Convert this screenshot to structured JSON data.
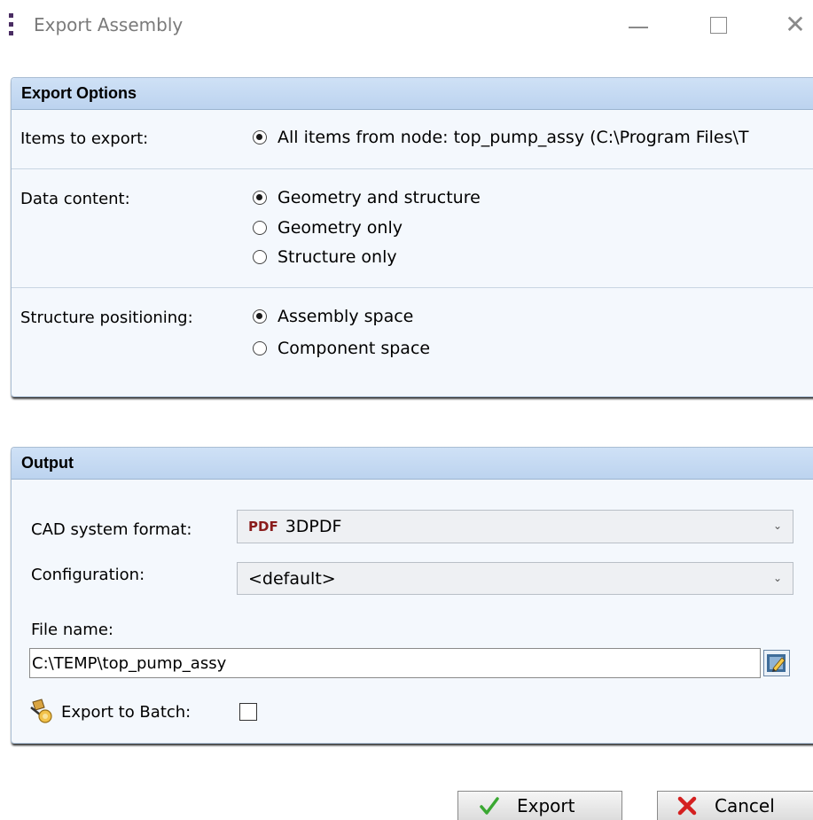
{
  "window": {
    "title": "Export Assembly",
    "minimize_icon": "minimize-icon",
    "maximize_icon": "maximize-icon",
    "close_icon": "close-icon"
  },
  "export_options": {
    "header": "Export Options",
    "items_to_export": {
      "label": "Items to export:",
      "options": [
        {
          "label": "All items from node: top_pump_assy (C:\\Program Files\\T",
          "selected": true
        }
      ]
    },
    "data_content": {
      "label": "Data content:",
      "options": [
        {
          "label": "Geometry and structure",
          "selected": true
        },
        {
          "label": "Geometry only",
          "selected": false
        },
        {
          "label": "Structure only",
          "selected": false
        }
      ]
    },
    "structure_positioning": {
      "label": "Structure positioning:",
      "options": [
        {
          "label": "Assembly space",
          "selected": true
        },
        {
          "label": "Component space",
          "selected": false
        }
      ]
    }
  },
  "output": {
    "header": "Output",
    "cad_format": {
      "label": "CAD system format:",
      "badge": "PDF",
      "value": "3DPDF"
    },
    "configuration": {
      "label": "Configuration:",
      "value": "<default>"
    },
    "file_name": {
      "label": "File name:",
      "value": "C:\\TEMP\\top_pump_assy"
    },
    "export_to_batch": {
      "label": "Export to Batch:",
      "checked": false
    }
  },
  "buttons": {
    "export": "Export",
    "cancel": "Cancel"
  },
  "colors": {
    "panel_bg": "#f4f8fd",
    "header_bg": "#c5daf3",
    "pdf_badge": "#8a1c1c",
    "export_check": "#3aa832",
    "cancel_x": "#d42020"
  }
}
